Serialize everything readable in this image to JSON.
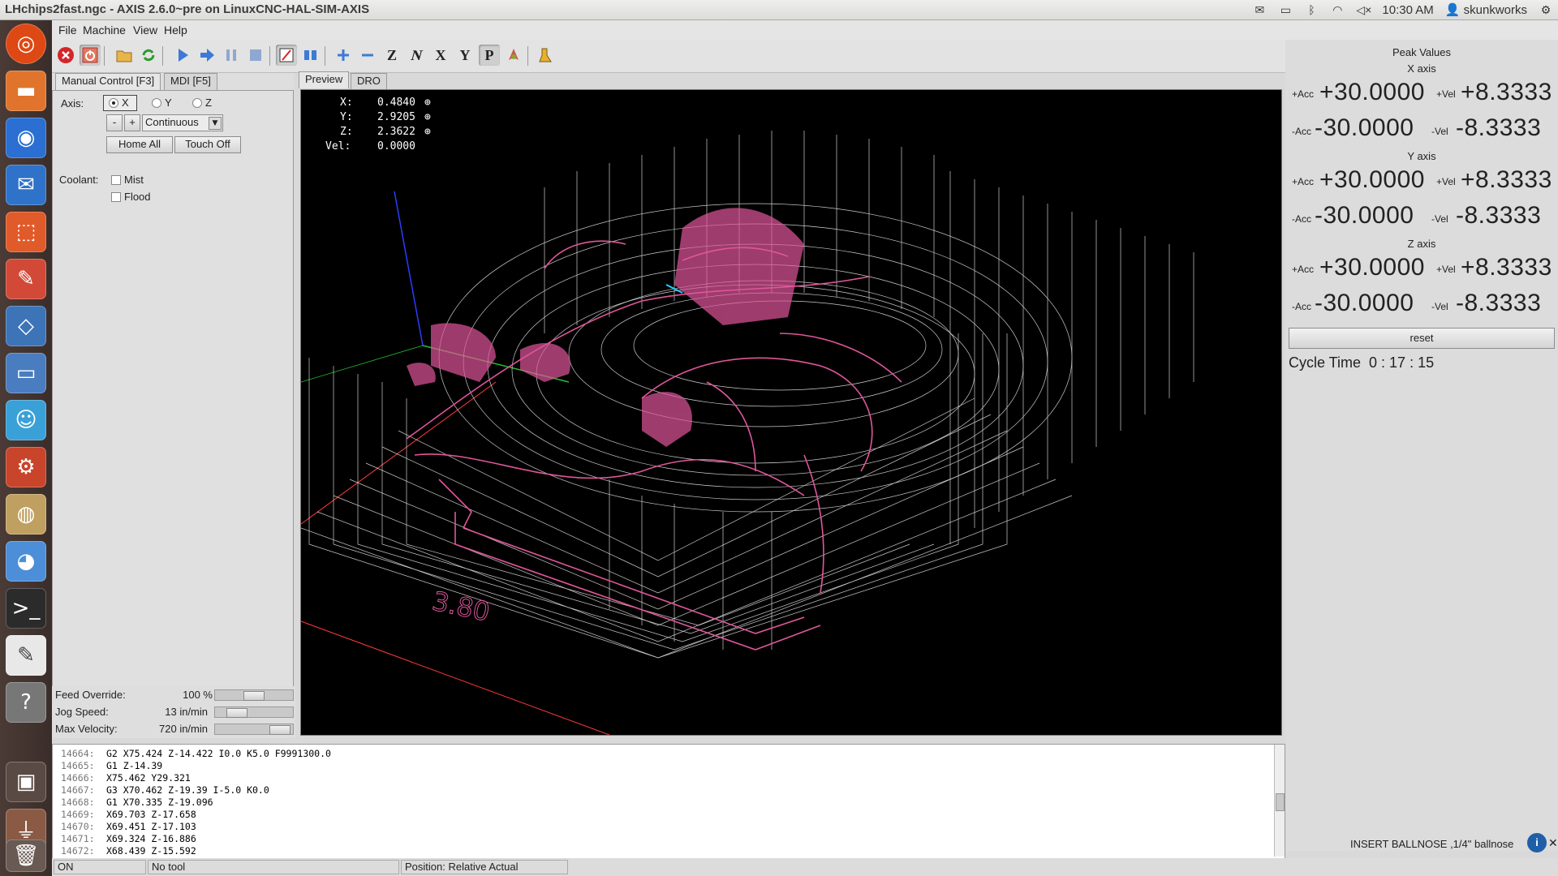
{
  "window": {
    "title": "LHchips2fast.ngc - AXIS 2.6.0~pre on LinuxCNC-HAL-SIM-AXIS",
    "clock": "10:30 AM",
    "user": "skunkworks"
  },
  "menu": [
    "File",
    "Machine",
    "View",
    "Help"
  ],
  "left_panel": {
    "tabs": [
      "Manual Control [F3]",
      "MDI [F5]"
    ],
    "axis_label": "Axis:",
    "axis_options": [
      "X",
      "Y",
      "Z"
    ],
    "axis_selected": "X",
    "jog_minus": "-",
    "jog_plus": "+",
    "jog_increment": "Continuous",
    "home_all": "Home All",
    "touch_off": "Touch Off",
    "coolant_label": "Coolant:",
    "coolant_options": [
      "Mist",
      "Flood"
    ],
    "feed_override_label": "Feed Override:",
    "feed_override_value": "100 %",
    "feed_override_level": 0.5,
    "jog_speed_label": "Jog Speed:",
    "jog_speed_value": "13 in/min",
    "jog_speed_level": 0.2,
    "max_velocity_label": "Max Velocity:",
    "max_velocity_value": "720 in/min",
    "max_velocity_level": 0.95
  },
  "preview": {
    "tabs": [
      "Preview",
      "DRO"
    ],
    "dro": [
      {
        "label": "X:",
        "value": "0.4840"
      },
      {
        "label": "Y:",
        "value": "2.9205"
      },
      {
        "label": "Z:",
        "value": "2.3622"
      },
      {
        "label": "Vel:",
        "value": "0.0000"
      }
    ],
    "dimension_label": "3.80"
  },
  "peak_values": {
    "title": "Peak Values",
    "axes": [
      {
        "name": "X axis",
        "pos_acc": "+30.0000",
        "pos_vel": "+8.3333",
        "neg_acc": "-30.0000",
        "neg_vel": "-8.3333"
      },
      {
        "name": "Y axis",
        "pos_acc": "+30.0000",
        "pos_vel": "+8.3333",
        "neg_acc": "-30.0000",
        "neg_vel": "-8.3333"
      },
      {
        "name": "Z axis",
        "pos_acc": "+30.0000",
        "pos_vel": "+8.3333",
        "neg_acc": "-30.0000",
        "neg_vel": "-8.3333"
      }
    ],
    "pos_acc_label": "+Acc",
    "pos_vel_label": "+Vel",
    "neg_acc_label": "-Acc",
    "neg_vel_label": "-Vel",
    "reset_label": "reset",
    "cycle_time_label": "Cycle Time",
    "cycle_time_value": "0 : 17 : 15",
    "tool_message": "INSERT BALLNOSE ,1/4\" ballnose"
  },
  "code": [
    {
      "line": "14664:",
      "text": "G2 X75.424 Z-14.422 I0.0 K5.0 F9991300.0"
    },
    {
      "line": "14665:",
      "text": "G1 Z-14.39"
    },
    {
      "line": "14666:",
      "text": "X75.462 Y29.321"
    },
    {
      "line": "14667:",
      "text": "G3 X70.462 Z-19.39 I-5.0 K0.0"
    },
    {
      "line": "14668:",
      "text": "G1 X70.335 Z-19.096"
    },
    {
      "line": "14669:",
      "text": "X69.703 Z-17.658"
    },
    {
      "line": "14670:",
      "text": "X69.451 Z-17.103"
    },
    {
      "line": "14671:",
      "text": "X69.324 Z-16.886"
    },
    {
      "line": "14672:",
      "text": "X68.439 Z-15.592"
    }
  ],
  "status": {
    "machine": "ON",
    "tool": "No tool",
    "position": "Position: Relative Actual"
  },
  "colors": {
    "toolpath_feed": "#e0569b",
    "toolpath_rapid": "#ffffff",
    "axis_x": "#ff3b3b",
    "axis_y": "#22c030",
    "axis_z": "#2c3cff"
  }
}
